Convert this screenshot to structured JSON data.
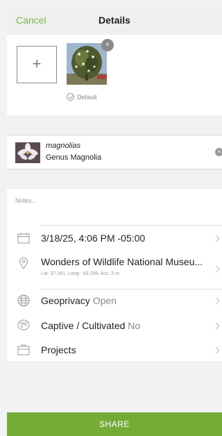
{
  "header": {
    "cancel_label": "Cancel",
    "title": "Details"
  },
  "photos": {
    "add_label": "+",
    "remove_label": "×",
    "default_label": "Default"
  },
  "taxon": {
    "scientific_name": "magnolias",
    "common_name": "Genus Magnolia",
    "clear_label": "×"
  },
  "notes": {
    "placeholder": "Notes..."
  },
  "details": {
    "datetime": "3/18/25, 4:06 PM -05:00",
    "location_name": "Wonders of Wildlife National Museu...",
    "location_coords": "Lat: 37.181, Long: -93.298, Acc: 3 m",
    "geoprivacy_label": "Geoprivacy",
    "geoprivacy_value": "Open",
    "captive_label": "Captive / Cultivated",
    "captive_value": "No",
    "projects_label": "Projects"
  },
  "footer": {
    "share_label": "SHARE"
  },
  "colors": {
    "accent": "#74ac36",
    "cancel_text": "#7ab648"
  },
  "icons": [
    "calendar-icon",
    "location-pin-icon",
    "globe-icon",
    "captive-icon",
    "projects-icon",
    "chevron-right-icon",
    "check-circle-icon",
    "clear-icon"
  ]
}
